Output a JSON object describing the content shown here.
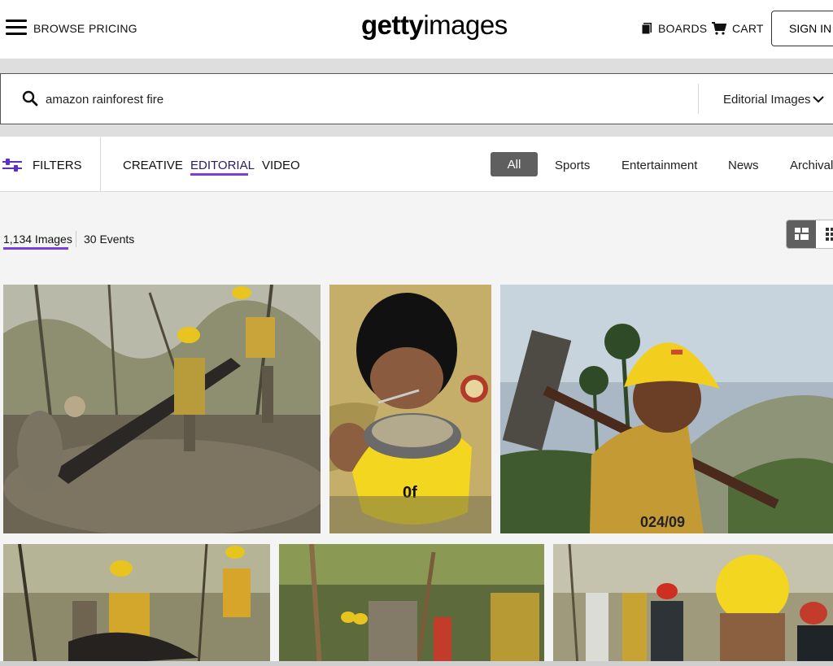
{
  "header": {
    "nav": {
      "browse": "BROWSE",
      "pricing": "PRICING"
    },
    "logo": {
      "part1": "getty",
      "part2": "images"
    },
    "boards": "BOARDS",
    "cart": "CART",
    "sign_in": "SIGN IN"
  },
  "search": {
    "query": "amazon rainforest fire",
    "type": "Editorial Images"
  },
  "filters": {
    "label": "FILTERS",
    "tabs": [
      "CREATIVE",
      "EDITORIAL",
      "VIDEO"
    ],
    "active_tab": "EDITORIAL",
    "categories": [
      "All",
      "Sports",
      "Entertainment",
      "News",
      "Archival"
    ],
    "active_category": "All"
  },
  "results": {
    "images_count": "1,134 Images",
    "events_count": "30 Events"
  },
  "helmet_text": {
    "number": "024/09",
    "mark": "0f"
  },
  "colors": {
    "accent": "#7a3ee0",
    "chip": "#5f5f5f",
    "helmet": "#f2d61f"
  }
}
